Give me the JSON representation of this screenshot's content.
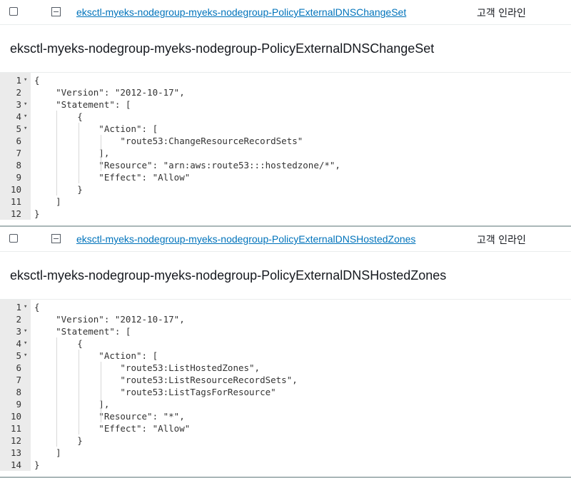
{
  "policies": [
    {
      "link": "eksctl-myeks-nodegroup-myeks-nodegroup-PolicyExternalDNSChangeSet",
      "type": "고객 인라인",
      "title": "eksctl-myeks-nodegroup-myeks-nodegroup-PolicyExternalDNSChangeSet",
      "code_lines": [
        {
          "n": "1",
          "fold": true,
          "text": "{"
        },
        {
          "n": "2",
          "fold": false,
          "text": "    \"Version\": \"2012-10-17\","
        },
        {
          "n": "3",
          "fold": true,
          "text": "    \"Statement\": ["
        },
        {
          "n": "4",
          "fold": true,
          "text": "        {"
        },
        {
          "n": "5",
          "fold": true,
          "text": "            \"Action\": ["
        },
        {
          "n": "6",
          "fold": false,
          "text": "                \"route53:ChangeResourceRecordSets\""
        },
        {
          "n": "7",
          "fold": false,
          "text": "            ],"
        },
        {
          "n": "8",
          "fold": false,
          "text": "            \"Resource\": \"arn:aws:route53:::hostedzone/*\","
        },
        {
          "n": "9",
          "fold": false,
          "text": "            \"Effect\": \"Allow\""
        },
        {
          "n": "10",
          "fold": false,
          "text": "        }"
        },
        {
          "n": "11",
          "fold": false,
          "text": "    ]"
        },
        {
          "n": "12",
          "fold": false,
          "text": "}"
        }
      ]
    },
    {
      "link": "eksctl-myeks-nodegroup-myeks-nodegroup-PolicyExternalDNSHostedZones",
      "type": "고객 인라인",
      "title": "eksctl-myeks-nodegroup-myeks-nodegroup-PolicyExternalDNSHostedZones",
      "code_lines": [
        {
          "n": "1",
          "fold": true,
          "text": "{"
        },
        {
          "n": "2",
          "fold": false,
          "text": "    \"Version\": \"2012-10-17\","
        },
        {
          "n": "3",
          "fold": true,
          "text": "    \"Statement\": ["
        },
        {
          "n": "4",
          "fold": true,
          "text": "        {"
        },
        {
          "n": "5",
          "fold": true,
          "text": "            \"Action\": ["
        },
        {
          "n": "6",
          "fold": false,
          "text": "                \"route53:ListHostedZones\","
        },
        {
          "n": "7",
          "fold": false,
          "text": "                \"route53:ListResourceRecordSets\","
        },
        {
          "n": "8",
          "fold": false,
          "text": "                \"route53:ListTagsForResource\""
        },
        {
          "n": "9",
          "fold": false,
          "text": "            ],"
        },
        {
          "n": "10",
          "fold": false,
          "text": "            \"Resource\": \"*\","
        },
        {
          "n": "11",
          "fold": false,
          "text": "            \"Effect\": \"Allow\""
        },
        {
          "n": "12",
          "fold": false,
          "text": "        }"
        },
        {
          "n": "13",
          "fold": false,
          "text": "    ]"
        },
        {
          "n": "14",
          "fold": false,
          "text": "}"
        }
      ]
    }
  ]
}
